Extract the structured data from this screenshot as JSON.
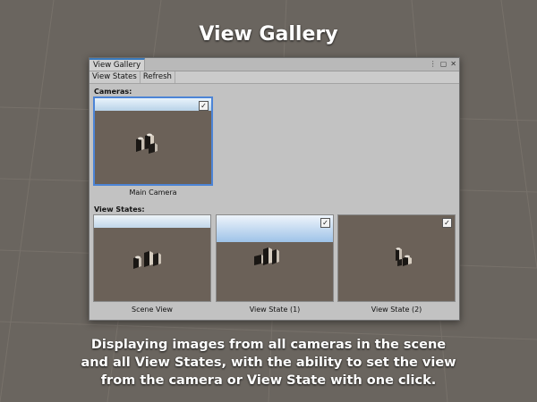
{
  "headline": "View Gallery",
  "caption_lines": [
    "Displaying images from all cameras in the scene",
    "and all View States, with the ability to set the view",
    "from the camera or View State with one click."
  ],
  "window": {
    "tab_title": "View Gallery",
    "icons": [
      "more-icon",
      "maximize-icon",
      "close-icon"
    ],
    "icon_glyphs": [
      "⋮",
      "▢",
      "✕"
    ],
    "toolbar": [
      "View States",
      "Refresh"
    ]
  },
  "sections": {
    "cameras_label": "Cameras:",
    "view_states_label": "View States:"
  },
  "cameras": [
    {
      "label": "Main Camera",
      "checked": true,
      "selected": true,
      "check_glyph": "✓"
    }
  ],
  "view_states": [
    {
      "label": "Scene View",
      "checked": false,
      "check_glyph": ""
    },
    {
      "label": "View State (1)",
      "checked": true,
      "check_glyph": "✓"
    },
    {
      "label": "View State (2)",
      "checked": true,
      "check_glyph": "✓"
    }
  ],
  "colors": {
    "accent": "#4c84d6",
    "scene_ground": "#6b6158",
    "window_bg": "#c2c2c2"
  }
}
